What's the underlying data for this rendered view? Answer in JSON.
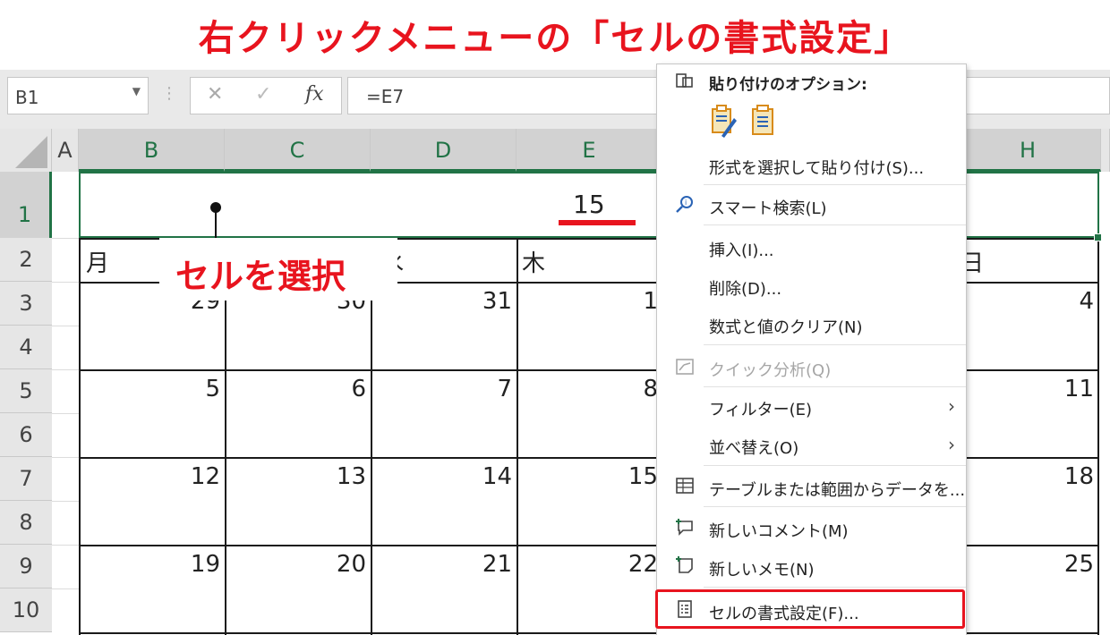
{
  "banner": {
    "title": "右クリックメニューの「セルの書式設定」"
  },
  "formula_bar": {
    "name_box": "B1",
    "formula": "=E7",
    "cancel_icon": "✕",
    "enter_icon": "✓",
    "fx_label": "fx"
  },
  "columns": [
    "A",
    "B",
    "C",
    "D",
    "E",
    "H"
  ],
  "rows": [
    "1",
    "2",
    "3",
    "4",
    "5",
    "6",
    "7",
    "8",
    "9",
    "10"
  ],
  "cells": {
    "e1": "15",
    "b2": "月",
    "e2": "木",
    "h2": "日",
    "d2_part": "水",
    "r3": [
      "29",
      "30",
      "31",
      "1",
      "4"
    ],
    "r5": [
      "5",
      "6",
      "7",
      "8",
      "11"
    ],
    "r7": [
      "12",
      "13",
      "14",
      "15",
      "18"
    ],
    "r9": [
      "19",
      "20",
      "21",
      "22",
      "25"
    ]
  },
  "callout": {
    "label": "セルを選択"
  },
  "context_menu": {
    "paste_header": "貼り付けのオプション:",
    "paste_special": "形式を選択して貼り付け(S)...",
    "smart_lookup": "スマート検索(L)",
    "insert": "挿入(I)...",
    "delete": "削除(D)...",
    "clear": "数式と値のクリア(N)",
    "quick_analysis": "クイック分析(Q)",
    "filter": "フィルター(E)",
    "sort": "並べ替え(O)",
    "table": "テーブルまたは範囲からデータを...",
    "new_comment": "新しいコメント(M)",
    "new_note": "新しいメモ(N)",
    "format_cells": "セルの書式設定(F)..."
  },
  "colors": {
    "accent_red": "#e8141e",
    "excel_green": "#217346"
  }
}
